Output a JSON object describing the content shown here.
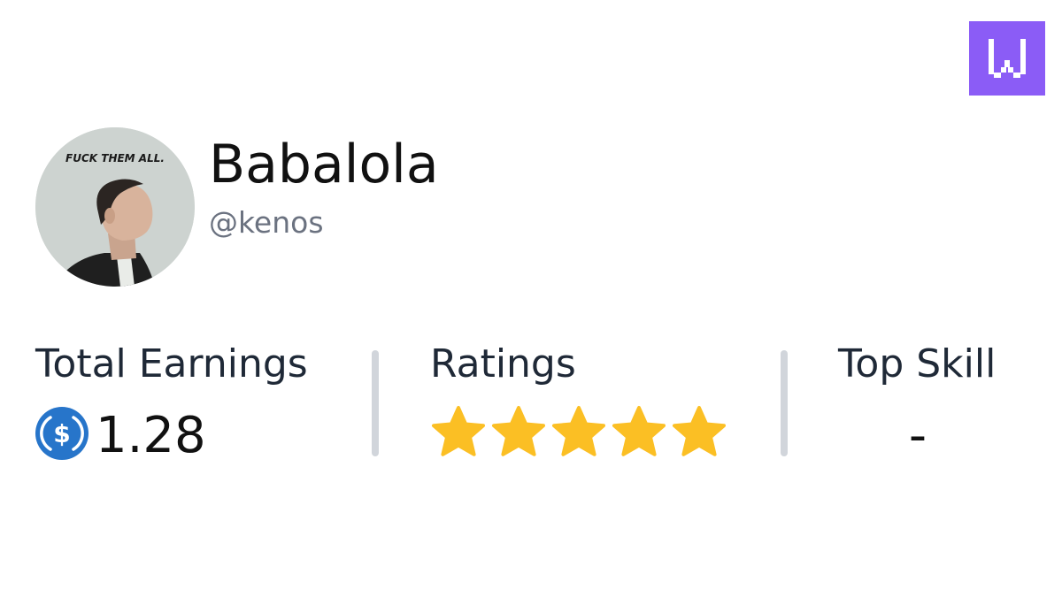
{
  "brand": {
    "logo_icon": "w-logo-icon",
    "accent_color": "#8b5cf6"
  },
  "profile": {
    "name": "Babalola",
    "handle": "@kenos",
    "avatar_caption": "FUCK THEM ALL.",
    "avatar_icon": "profile-photo"
  },
  "stats": {
    "earnings": {
      "label": "Total Earnings",
      "value": "1.28",
      "currency_icon": "usdc-coin-icon",
      "currency_color": "#2775ca"
    },
    "ratings": {
      "label": "Ratings",
      "stars_filled": 5,
      "stars_total": 5,
      "star_icon": "star-icon",
      "star_color": "#fbbf24"
    },
    "top_skill": {
      "label": "Top Skill",
      "value": "-"
    }
  }
}
